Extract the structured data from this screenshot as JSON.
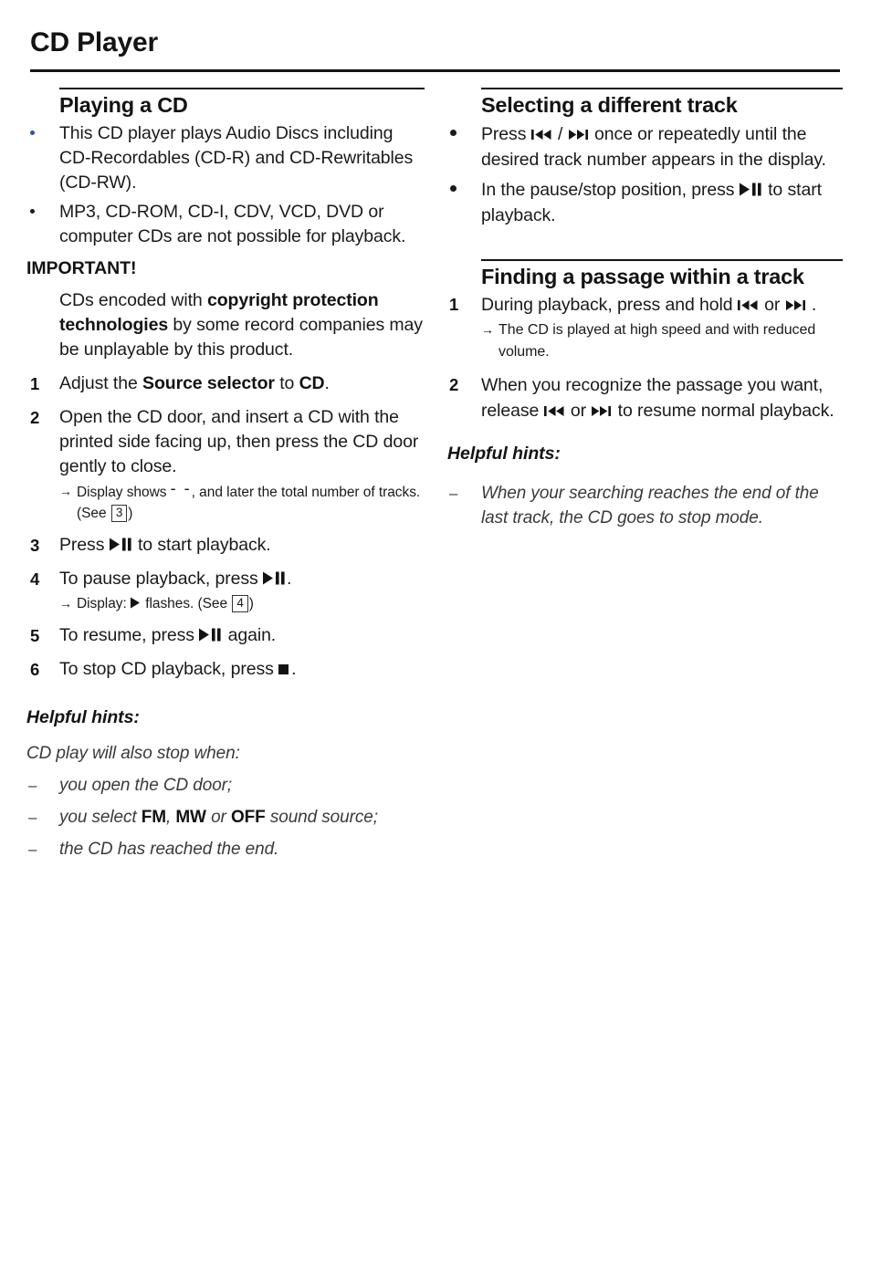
{
  "document": {
    "page_title": "CD Player"
  },
  "left_column": {
    "section1": {
      "heading": "Playing a CD",
      "bullets": [
        "This CD player plays Audio Discs including CD-Recordables (CD-R) and CD-Rewritables (CD-RW).",
        "MP3, CD-ROM, CD-I, CDV, VCD, DVD or computer CDs are not possible for playback."
      ],
      "important_label": "IMPORTANT!",
      "important_text_1": "CDs encoded with ",
      "important_bold_1": "copyright protection technologies",
      "important_text_2": " by some record companies may be unplayable by this product.",
      "steps": [
        {
          "number": "1",
          "text_1": "Adjust the ",
          "bold_1": "Source selector",
          "text_2": " to ",
          "bold_2": "CD",
          "text_3": "."
        },
        {
          "number": "2",
          "text_1": "Open the CD door, and insert a CD with the printed side facing up, then press the CD door gently to close.",
          "sub": {
            "arrow": "→",
            "text_1": "Display shows ",
            "dashes": "- -",
            "text_2": ", and later the total number of tracks. (See ",
            "box": "3",
            "text_3": ")"
          }
        },
        {
          "number": "3",
          "text_1": "Press ",
          "glyph_1": "play-pause",
          "text_2": " to start playback."
        },
        {
          "number": "4",
          "text_1": "To pause playback, press ",
          "glyph_1": "play-pause",
          "text_2": ".",
          "sub": {
            "arrow": "→",
            "text_1": "Display: ",
            "glyph_1": "play",
            "text_2": " flashes. (See ",
            "box": "4",
            "text_3": ")"
          }
        },
        {
          "number": "5",
          "text_1": "To resume, press ",
          "glyph_1": "play-pause",
          "text_2": " again."
        },
        {
          "number": "6",
          "text_1": "To stop CD playback, press ",
          "glyph_1": "stop",
          "text_2": "."
        }
      ],
      "hints_heading": "Helpful hints:",
      "hints_intro": "CD play will also stop when:",
      "hints": [
        {
          "dash": "–",
          "text_1": "you open the CD door;"
        },
        {
          "dash": "–",
          "text_1": "you select ",
          "bold_1": "FM",
          "text_2": ", ",
          "bold_2": "MW",
          "text_3": " or ",
          "bold_3": "OFF",
          "text_4": " sound source;"
        },
        {
          "dash": "–",
          "text_1": "the CD has reached the end."
        }
      ]
    }
  },
  "right_column": {
    "section1": {
      "heading": "Selecting a different track",
      "bullets": [
        {
          "text_1": "Press ",
          "glyph_1": "skip-back",
          "text_2": " / ",
          "glyph_2": "skip-forward",
          "text_3": " once or repeatedly until the desired track number appears in the display."
        },
        {
          "text_1": "In the pause/stop position, press ",
          "glyph_1": "play-pause",
          "text_2": " to start playback."
        }
      ]
    },
    "section2": {
      "heading": "Finding a passage within a track",
      "steps": [
        {
          "number": "1",
          "text_1": "During playback, press and hold ",
          "glyph_1": "skip-back",
          "text_2": " or ",
          "glyph_2": "skip-forward",
          "text_3": " .",
          "sub": {
            "arrow": "→",
            "text_1": "The CD is played at high speed and with reduced volume."
          }
        },
        {
          "number": "2",
          "text_1": "When you recognize the passage you want, release ",
          "glyph_1": "skip-back",
          "text_2": " or ",
          "glyph_2": "skip-forward",
          "text_3": " to resume normal playback."
        }
      ],
      "hints_heading": "Helpful hints:",
      "hints": [
        {
          "dash": "–",
          "text_1": "When your searching reaches the end of the last track, the CD goes to stop mode."
        }
      ]
    }
  },
  "colors": {
    "text": "#1a1a1a",
    "heading": "#131313",
    "rule": "#131313",
    "bullet_blue": "#2e53a0",
    "italic_gray": "#3a3a3a"
  }
}
